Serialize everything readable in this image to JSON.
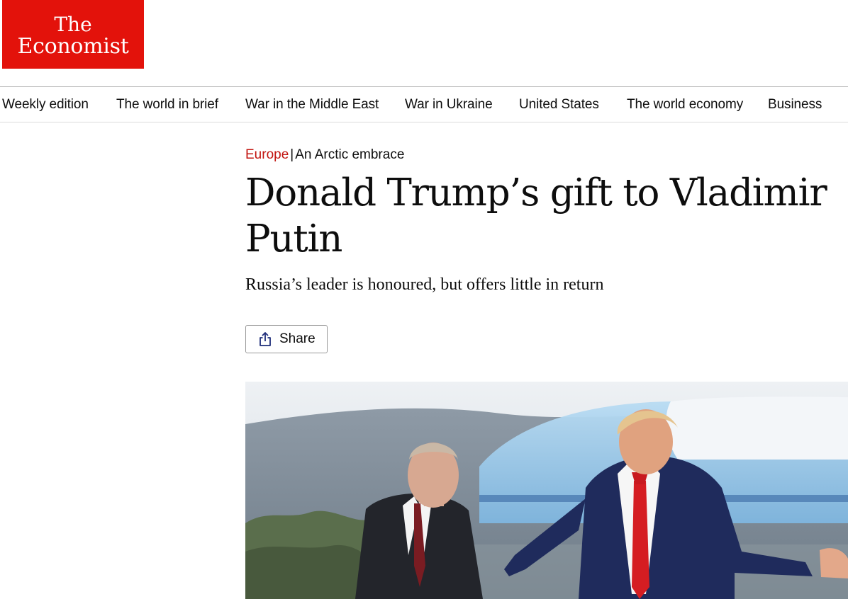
{
  "brand": {
    "line1": "The",
    "line2": "Economist",
    "color": "#e3120b"
  },
  "nav": {
    "items": [
      {
        "label": "Weekly edition"
      },
      {
        "label": "The world in brief"
      },
      {
        "label": "War in the Middle East"
      },
      {
        "label": "War in Ukraine"
      },
      {
        "label": "United States"
      },
      {
        "label": "The world economy"
      },
      {
        "label": "Business"
      }
    ]
  },
  "article": {
    "section": "Europe",
    "separator": "|",
    "flytitle": "An Arctic embrace",
    "headline": "Donald Trump’s gift to Vladimir Putin",
    "standfirst": "Russia’s leader is honoured, but offers little in return",
    "share_label": "Share",
    "section_color": "#c2140f"
  },
  "hero_image": {
    "icon": "photo-of-two-leaders-on-airfield"
  }
}
